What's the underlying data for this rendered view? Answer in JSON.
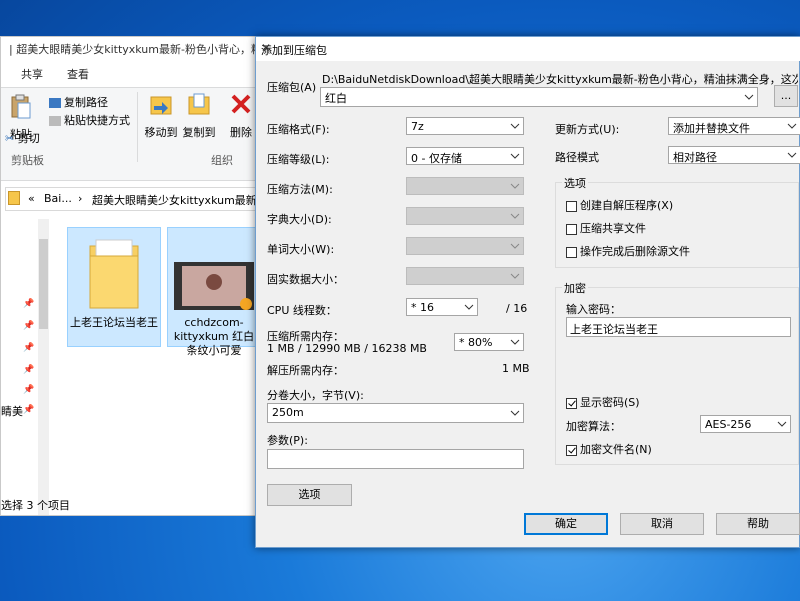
{
  "explorer": {
    "title": "| 超美大眼睛美少女kittyxkum最新-粉色小背心，精油",
    "tabs": [
      "共享",
      "查看"
    ],
    "ribbon": {
      "paste": "粘贴",
      "copy_path": "复制路径",
      "paste_shortcut": "粘贴快捷方式",
      "cut": "剪切",
      "move_to": "移动到",
      "copy_to": "复制到",
      "delete": "删除",
      "clipboard_group": "剪贴板",
      "organize_group": "组织"
    },
    "address": {
      "prefix": "«",
      "segment1": "Bai...",
      "sep": "›",
      "segment2": "超美大眼睛美少女kittyxkum最新-粉"
    },
    "nav_item": "睛美",
    "files": [
      {
        "name": "上老王论坛当老王"
      },
      {
        "name": "cchdzcom-kittyxkum   红白条纹小可爱"
      }
    ],
    "status": "选择 3 个项目"
  },
  "dialog": {
    "title": "添加到压缩包",
    "close": "✕",
    "archive_label": "压缩包(A)",
    "archive_path": "D:\\BaiduNetdiskDownload\\超美大眼睛美少女kittyxkum最新-粉色小背心，精油抹满全身，这次这根鸡巴真",
    "archive_name": "红白",
    "browse": "...",
    "format_label": "压缩格式(F):",
    "format_value": "7z",
    "level_label": "压缩等级(L):",
    "level_value": "0 - 仅存储",
    "method_label": "压缩方法(M):",
    "dict_label": "字典大小(D):",
    "word_label": "单词大小(W):",
    "solid_label": "固实数据大小：",
    "threads_label": "CPU 线程数：",
    "threads_value": "* 16",
    "threads_max": "/ 16",
    "mem_label": "压缩所需内存：",
    "mem_value": "1 MB / 12990 MB / 16238 MB",
    "mem_percent": "* 80%",
    "decomp_label": "解压所需内存：",
    "decomp_value": "1 MB",
    "split_label": "分卷大小，字节(V):",
    "split_value": "250m",
    "params_label": "参数(P):",
    "params_value": "",
    "options_btn": "选项",
    "update_label": "更新方式(U):",
    "update_value": "添加并替换文件",
    "path_label": "路径模式",
    "path_value": "相对路径",
    "options_group": "选项",
    "opt_sfx": "创建自解压程序(X)",
    "opt_shared": "压缩共享文件",
    "opt_delete": "操作完成后删除源文件",
    "encrypt_group": "加密",
    "password_label": "输入密码：",
    "password_value": "上老王论坛当老王",
    "show_password": "显示密码(S)",
    "algo_label": "加密算法：",
    "algo_value": "AES-256",
    "encrypt_names": "加密文件名(N)",
    "ok": "确定",
    "cancel": "取消",
    "help": "帮助"
  }
}
